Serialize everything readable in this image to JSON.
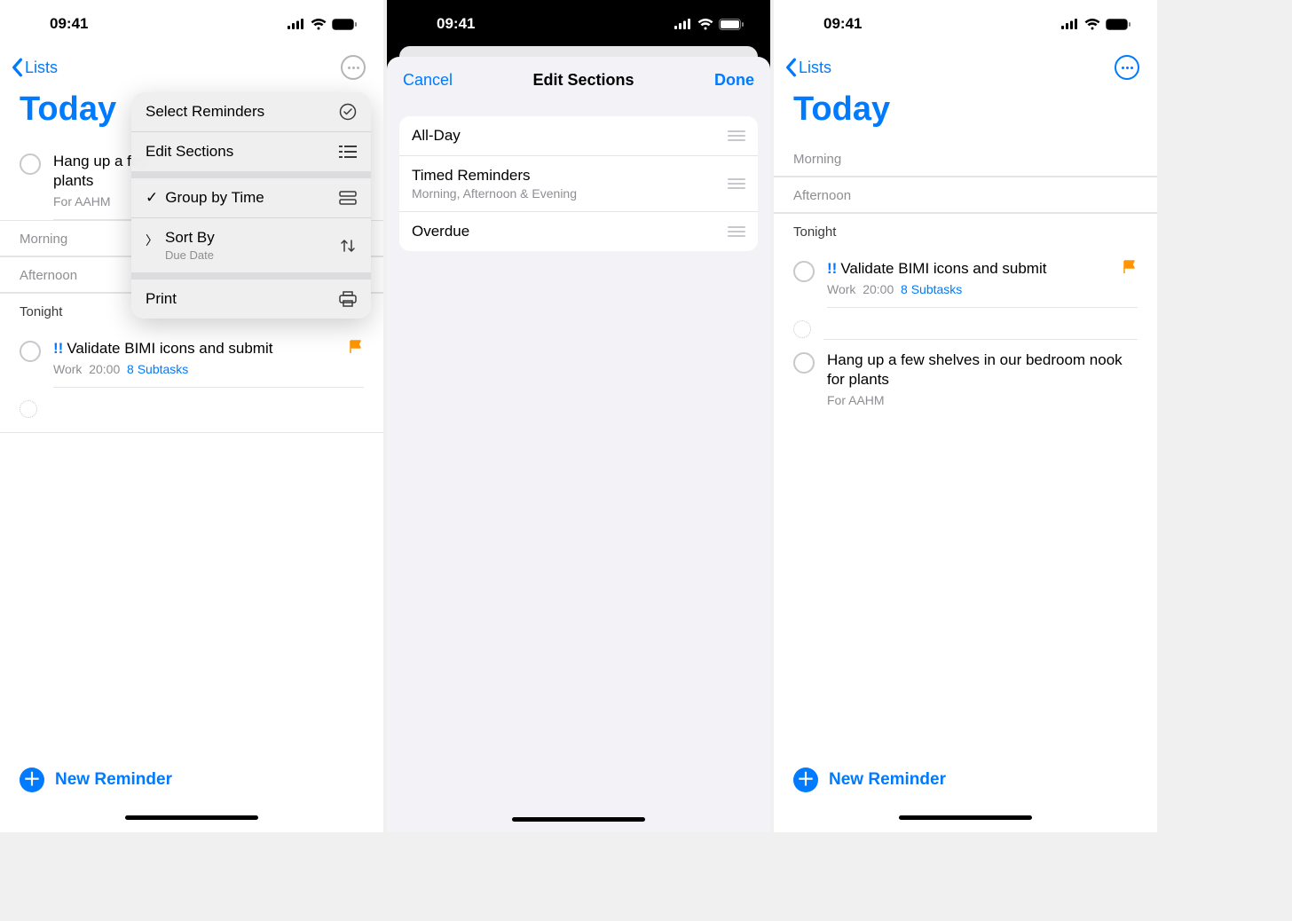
{
  "status": {
    "time": "09:41"
  },
  "screen1": {
    "back_label": "Lists",
    "title": "Today",
    "menu": {
      "select_reminders": "Select Reminders",
      "edit_sections": "Edit Sections",
      "group_by_time": "Group by Time",
      "sort_by": "Sort By",
      "sort_by_sub": "Due Date",
      "print": "Print"
    },
    "reminder1": {
      "title": "Hang up a few",
      "line2": "plants",
      "meta": "For AAHM"
    },
    "sections": {
      "morning": "Morning",
      "afternoon": "Afternoon",
      "tonight": "Tonight"
    },
    "reminder2": {
      "priority": "!!",
      "title": "Validate BIMI icons and submit",
      "meta_list": "Work",
      "meta_time": "20:00",
      "subtasks": "8 Subtasks"
    },
    "new_reminder": "New Reminder"
  },
  "screen2": {
    "cancel": "Cancel",
    "title": "Edit Sections",
    "done": "Done",
    "cells": {
      "all_day": "All-Day",
      "timed": "Timed Reminders",
      "timed_sub": "Morning, Afternoon & Evening",
      "overdue": "Overdue"
    }
  },
  "screen3": {
    "back_label": "Lists",
    "title": "Today",
    "sections": {
      "morning": "Morning",
      "afternoon": "Afternoon",
      "tonight": "Tonight"
    },
    "reminder1": {
      "priority": "!!",
      "title": "Validate BIMI icons and submit",
      "meta_list": "Work",
      "meta_time": "20:00",
      "subtasks": "8 Subtasks"
    },
    "reminder2": {
      "title": "Hang up a few shelves in our bedroom nook for plants",
      "meta": "For AAHM"
    },
    "new_reminder": "New Reminder"
  }
}
